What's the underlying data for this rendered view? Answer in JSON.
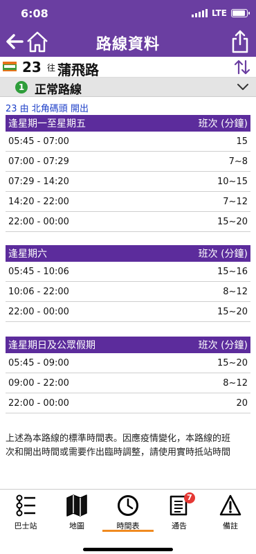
{
  "status": {
    "time": "6:08",
    "network": "LTE"
  },
  "header": {
    "title": "路線資料"
  },
  "route": {
    "number": "23",
    "to_label": "往",
    "destination": "蒲飛路"
  },
  "variant": {
    "badge": "1",
    "label": "正常路線"
  },
  "depart_info": "23 由 北角碼頭 開出",
  "timetables": [
    {
      "day": "逢星期一至星期五",
      "freq_header": "班次 (分鐘)",
      "rows": [
        {
          "period": "05:45 - 07:00",
          "freq": "15"
        },
        {
          "period": "07:00 - 07:29",
          "freq": "7~8"
        },
        {
          "period": "07:29 - 14:20",
          "freq": "10~15"
        },
        {
          "period": "14:20 - 22:00",
          "freq": "7~12"
        },
        {
          "period": "22:00 - 00:00",
          "freq": "15~20"
        }
      ]
    },
    {
      "day": "逢星期六",
      "freq_header": "班次 (分鐘)",
      "rows": [
        {
          "period": "05:45 - 10:06",
          "freq": "15~16"
        },
        {
          "period": "10:06 - 22:00",
          "freq": "8~12"
        },
        {
          "period": "22:00 - 00:00",
          "freq": "15~20"
        }
      ]
    },
    {
      "day": "逢星期日及公眾假期",
      "freq_header": "班次 (分鐘)",
      "rows": [
        {
          "period": "05:45 - 09:00",
          "freq": "15~20"
        },
        {
          "period": "09:00 - 22:00",
          "freq": "8~12"
        },
        {
          "period": "22:00 - 00:00",
          "freq": "20"
        }
      ]
    }
  ],
  "notice": {
    "line1": "上述為本路線的標準時間表。因應疫情變化，本路線的班",
    "line2": "次和開出時間或需要作出臨時調整，請使用實時抵站時間"
  },
  "tabs": [
    {
      "label": "巴士站",
      "icon": "bus-stop-icon"
    },
    {
      "label": "地圖",
      "icon": "map-icon"
    },
    {
      "label": "時間表",
      "icon": "clock-icon",
      "active": true
    },
    {
      "label": "通告",
      "icon": "notice-icon",
      "badge": "7"
    },
    {
      "label": "備註",
      "icon": "warning-icon"
    }
  ],
  "colors": {
    "header": "#6a3ea1",
    "table_header": "#5c2c9c",
    "active_tab": "#f08a20",
    "variant_badge": "#2e9d3a",
    "depart_text": "#1d3fc8"
  }
}
